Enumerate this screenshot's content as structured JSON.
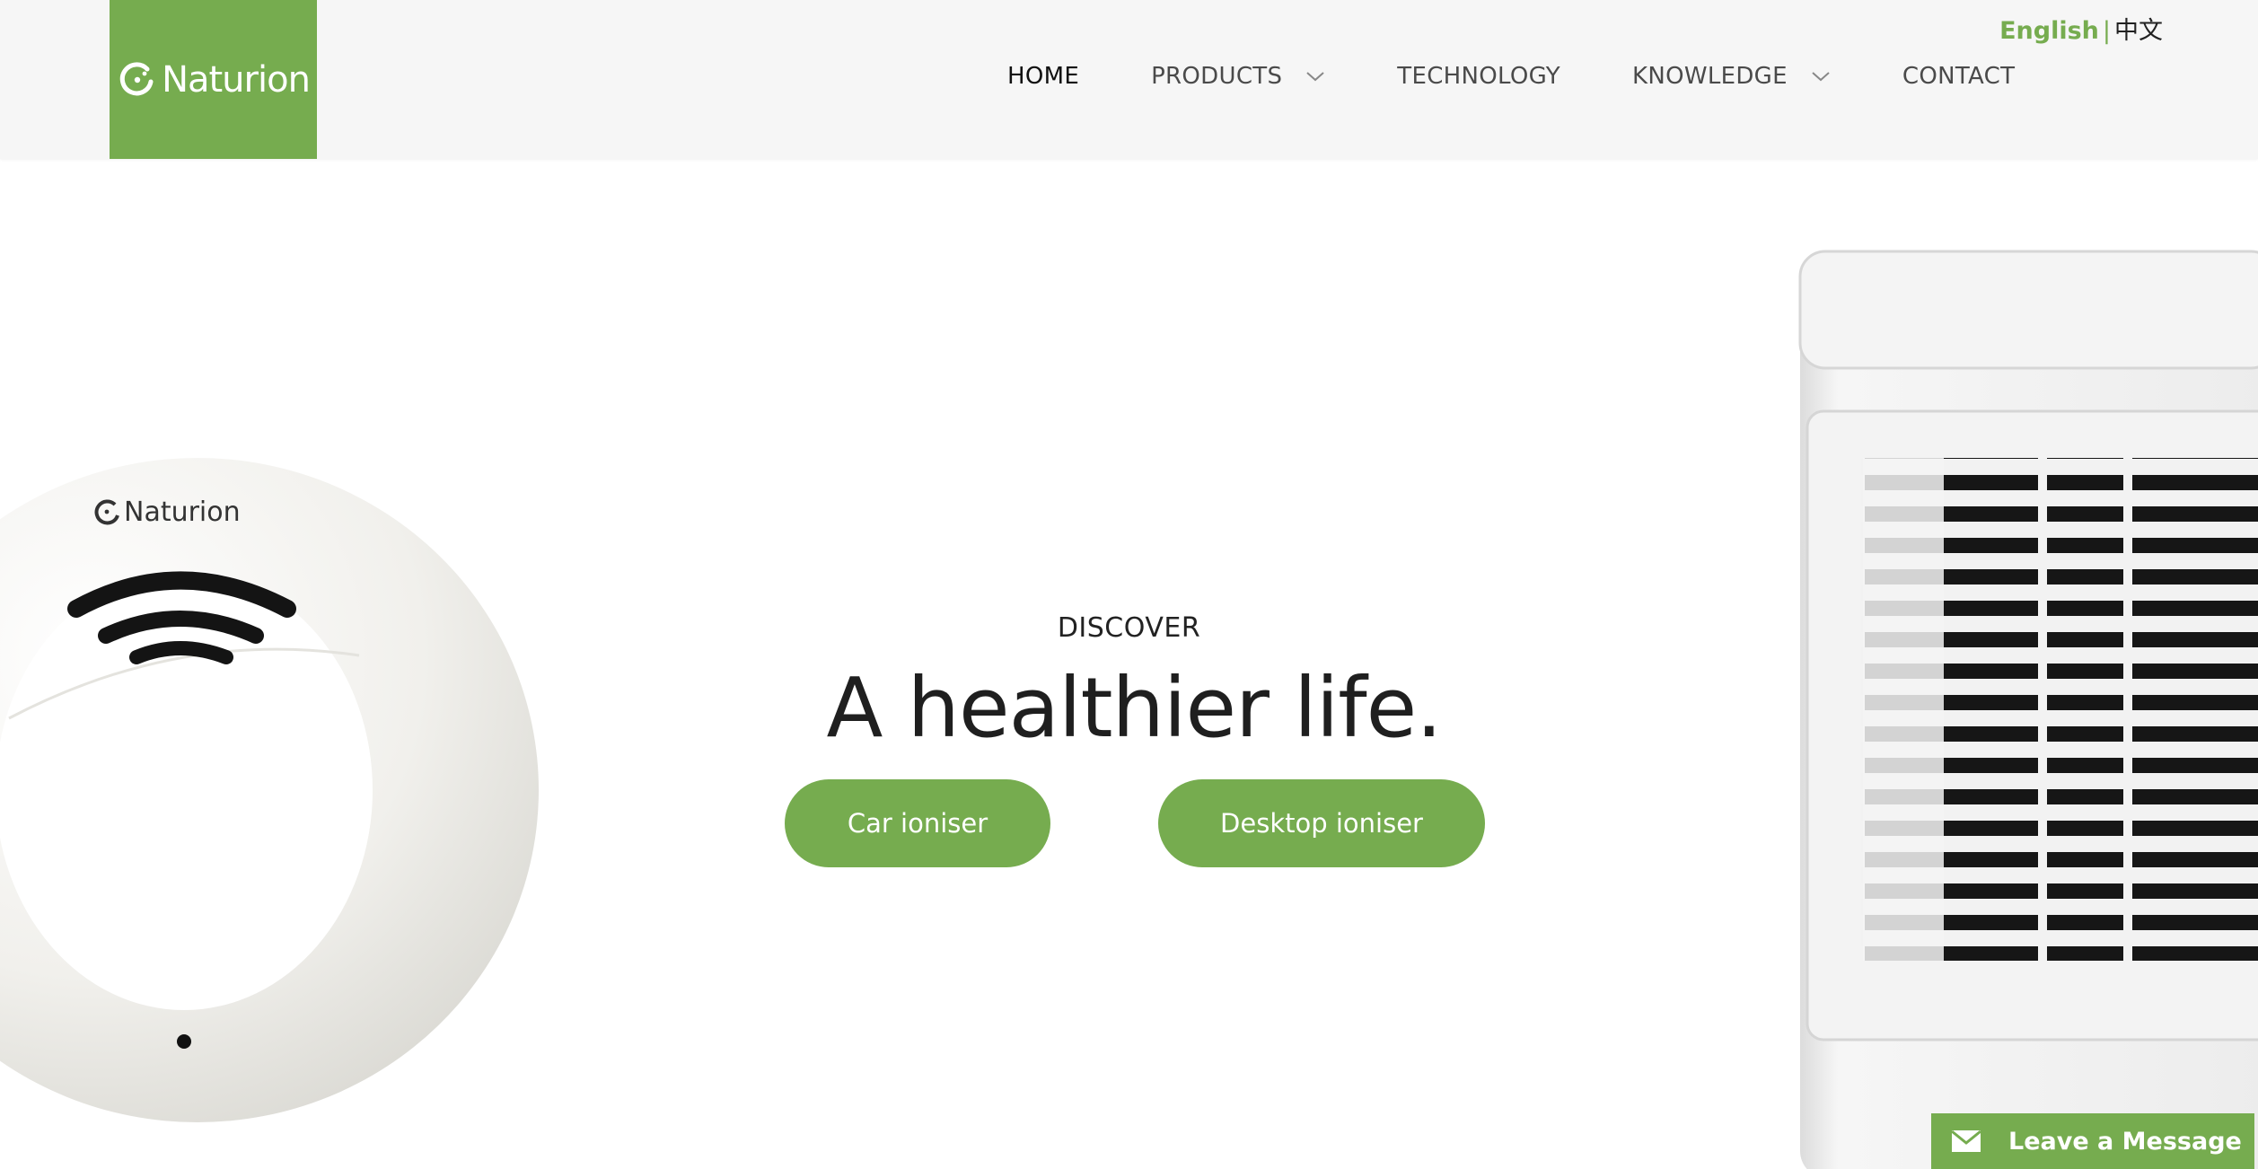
{
  "brand": {
    "name": "Naturion",
    "accent": "#76ac4f"
  },
  "language": {
    "english": "English",
    "separator": "|",
    "chinese": "中文"
  },
  "nav": {
    "home": "HOME",
    "products": "PRODUCTS",
    "technology": "TECHNOLOGY",
    "knowledge": "KNOWLEDGE",
    "contact": "CONTACT"
  },
  "hero": {
    "eyebrow": "DISCOVER",
    "headline": "A healthier life.",
    "btn_car": "Car ioniser",
    "btn_desktop": "Desktop ioniser",
    "product_left_brand": "Naturion"
  },
  "chat": {
    "label": "Leave a Message",
    "icon": "envelope-icon"
  }
}
